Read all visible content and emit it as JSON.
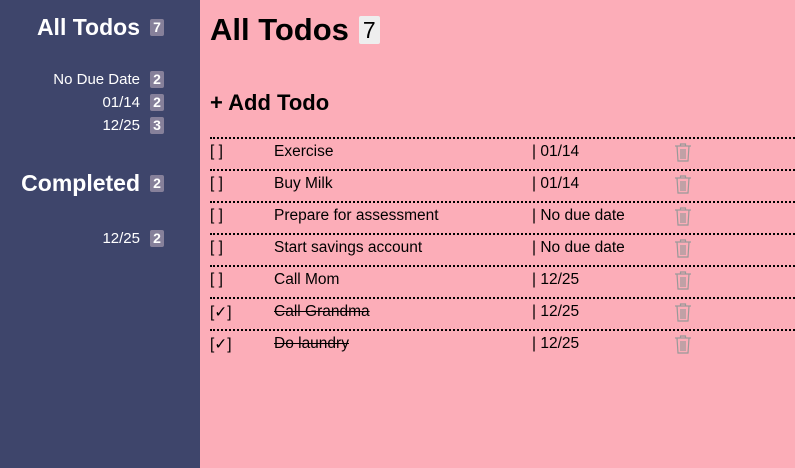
{
  "sidebar": {
    "all": {
      "title": "All Todos",
      "count": "7",
      "groups": [
        {
          "label": "No Due Date",
          "count": "2"
        },
        {
          "label": "01/14",
          "count": "2"
        },
        {
          "label": "12/25",
          "count": "3"
        }
      ]
    },
    "completed": {
      "title": "Completed",
      "count": "2",
      "groups": [
        {
          "label": "12/25",
          "count": "2"
        }
      ]
    }
  },
  "main": {
    "title": "All Todos",
    "count": "7",
    "add_label": "+ Add Todo",
    "todos": [
      {
        "check": "[  ]",
        "title": "Exercise",
        "due": "| 01/14",
        "done": false
      },
      {
        "check": "[  ]",
        "title": "Buy Milk",
        "due": "| 01/14",
        "done": false
      },
      {
        "check": "[  ]",
        "title": "Prepare for assessment",
        "due": "| No due date",
        "done": false
      },
      {
        "check": "[  ]",
        "title": "Start savings account",
        "due": "| No due date",
        "done": false
      },
      {
        "check": "[  ]",
        "title": "Call Mom",
        "due": "| 12/25",
        "done": false
      },
      {
        "check": "[✓]",
        "title": "Call Grandma",
        "due": "| 12/25",
        "done": true
      },
      {
        "check": "[✓]",
        "title": "Do laundry",
        "due": "| 12/25",
        "done": true
      }
    ]
  },
  "colors": {
    "sidebar_bg": "#3e456b",
    "main_bg": "#fcadb8",
    "badge_bg": "#86809a",
    "trash_icon": "#999999"
  },
  "icons": {
    "trash": "trash-icon"
  }
}
